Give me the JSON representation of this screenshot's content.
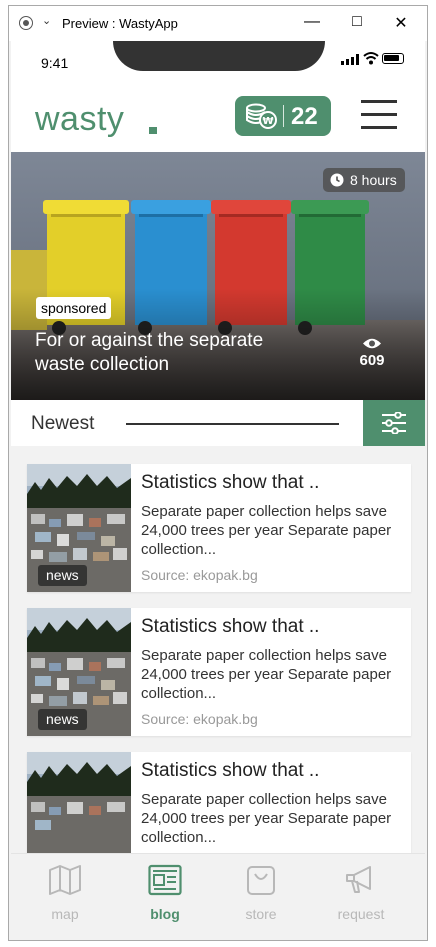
{
  "window": {
    "title": "Preview : WastyApp"
  },
  "status_bar": {
    "time": "9:41"
  },
  "header": {
    "logo": "wasty",
    "coins": "22"
  },
  "hero": {
    "time_ago": "8 hours",
    "badge": "sponsored",
    "title": "For or against the separate waste collection",
    "views": "609"
  },
  "section": {
    "title": "Newest"
  },
  "articles": [
    {
      "title": "Statistics show that ..",
      "excerpt": "Separate paper collection helps save 24,000 trees per year Separate paper collection...",
      "source": "Source: ekopak.bg",
      "tag": "news"
    },
    {
      "title": "Statistics show that ..",
      "excerpt": "Separate paper collection helps save 24,000 trees per year Separate paper collection...",
      "source": "Source: ekopak.bg",
      "tag": "news"
    },
    {
      "title": "Statistics show that ..",
      "excerpt": "Separate paper collection helps save 24,000 trees per year Separate paper collection...",
      "source": "",
      "tag": ""
    }
  ],
  "tabs": [
    {
      "label": "map",
      "icon": "map-icon",
      "active": false
    },
    {
      "label": "blog",
      "icon": "newspaper-icon",
      "active": true
    },
    {
      "label": "store",
      "icon": "bag-icon",
      "active": false
    },
    {
      "label": "request",
      "icon": "megaphone-icon",
      "active": false
    }
  ],
  "colors": {
    "brand": "#4f8f6e",
    "inactive": "#b8b8b8"
  }
}
